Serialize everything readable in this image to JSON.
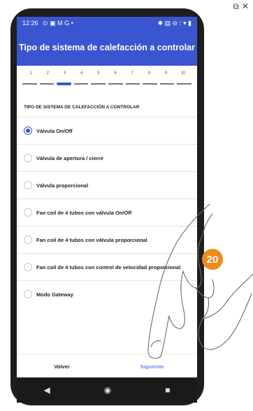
{
  "status_bar": {
    "time": "12:26",
    "left_icons": "⊙ ▣ M G •",
    "right_icons": "✱ ▤ ⊖ ⁝ ▾ ▮"
  },
  "corner_icons": [
    "external-link-icon",
    "close-icon"
  ],
  "app_bar": {
    "title": "Tipo de sistema de calefacción a controlar"
  },
  "stepper": {
    "steps": [
      "1",
      "2",
      "3",
      "4",
      "5",
      "6",
      "7",
      "8",
      "9",
      "10"
    ],
    "current_step": 3
  },
  "section_label": "TIPO DE SISTEMA DE CALEFACCIÓN A CONTROLAR",
  "options": [
    {
      "label": "Válvula On/Off",
      "selected": true
    },
    {
      "label": "Válvula de apertura / cierre",
      "selected": false
    },
    {
      "label": "Válvula proporcional",
      "selected": false
    },
    {
      "label": "Fan coil de 4 tubos con válvula On/Off",
      "selected": false
    },
    {
      "label": "Fan coil de 4 tubos con válvula proporcional",
      "selected": false
    },
    {
      "label": "Fan coil de 4 tubos con control de velocidad proporcional",
      "selected": false
    },
    {
      "label": "Modo Gateway",
      "selected": false
    }
  ],
  "footer": {
    "back_label": "Volver",
    "next_label": "Siguiente"
  },
  "nav_bar": [
    "back-triangle-icon",
    "home-circle-icon",
    "recents-square-icon"
  ],
  "annotation": {
    "step_number": "20"
  },
  "colors": {
    "primary": "#3a55d0",
    "next_text": "#6f86e6",
    "badge": "#f08a1d"
  }
}
